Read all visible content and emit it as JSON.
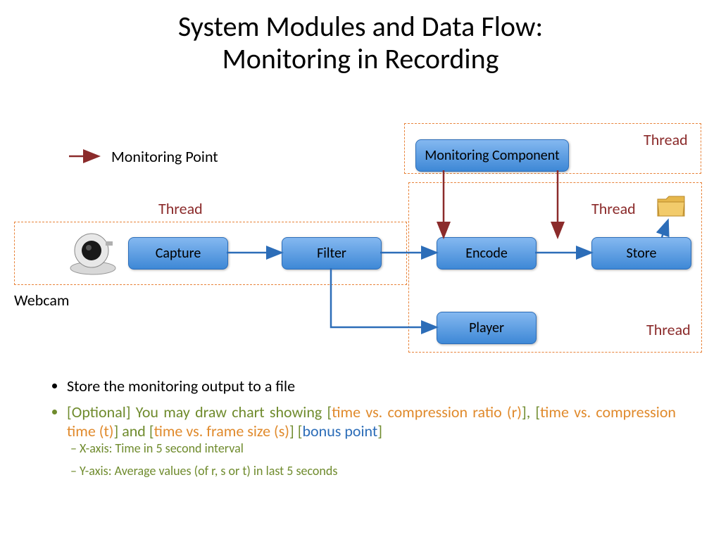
{
  "title_line1": "System Modules and Data Flow:",
  "title_line2": "Monitoring in Recording",
  "legend": "Monitoring Point",
  "webcam": "Webcam",
  "thread_labels": {
    "top": "Thread",
    "left": "Thread",
    "right": "Thread",
    "bottom": "Thread"
  },
  "modules": {
    "monitor": "Monitoring Component",
    "capture": "Capture",
    "filter": "Filter",
    "encode": "Encode",
    "store": "Store",
    "player": "Player"
  },
  "bullets": {
    "b1": "Store the monitoring output to a file",
    "b2_pre": "[Optional] You may draw chart showing ",
    "b2_brk1o": "[",
    "b2_c1": "time vs. compression ratio (r)",
    "b2_brk1c": "]",
    "b2_sep": ", ",
    "b2_brk2o": "[",
    "b2_c2": "time vs. compression time (t)",
    "b2_brk2c": "]",
    "b2_and": " and ",
    "b2_brk3o": "[",
    "b2_c3": "time vs. frame size (s)",
    "b2_brk3c": "]",
    "b2_sp": " ",
    "b2_brk4o": "[",
    "b2_bonus": "bonus point",
    "b2_brk4c": "]",
    "s1": "X-axis: Time in 5 second interval",
    "s2": "Y-axis: Average values (of r, s or t)  in last 5 seconds"
  }
}
